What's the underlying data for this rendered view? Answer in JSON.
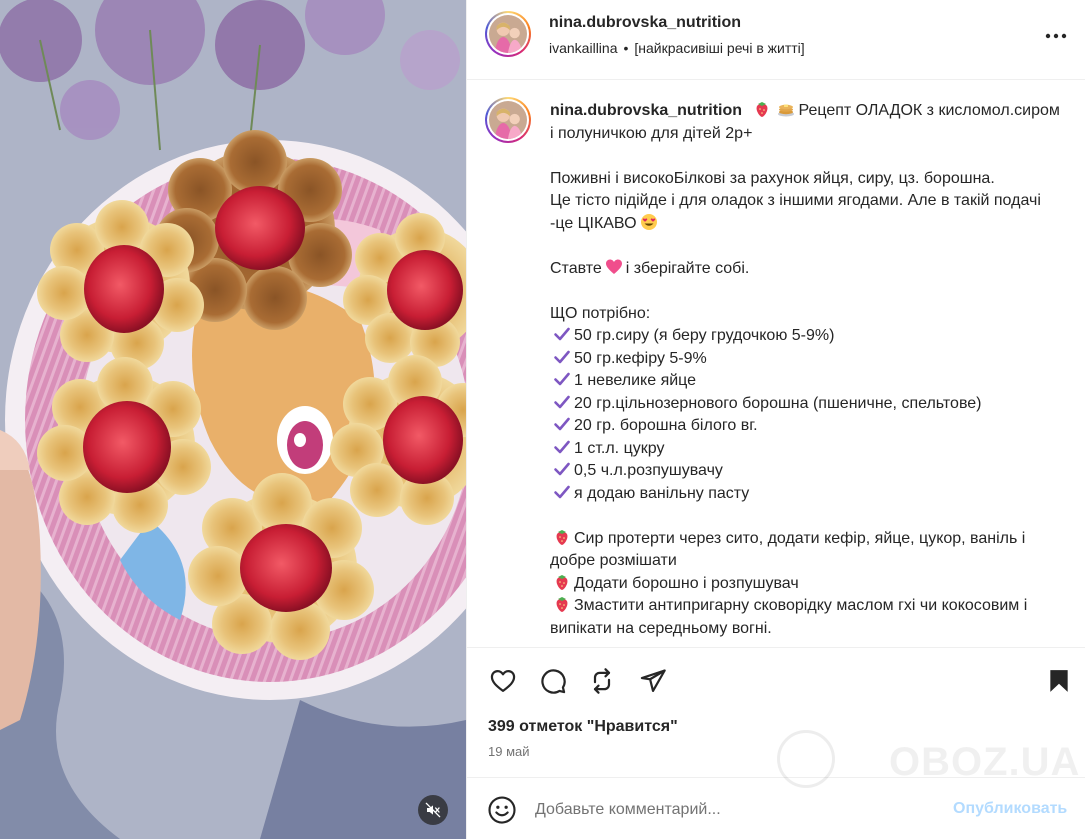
{
  "header": {
    "username": "nina.dubrovska_nutrition",
    "audio_artist": "ivankaillina",
    "audio_track": "[найкрасивіші речі в житті]",
    "separator": "•"
  },
  "caption": {
    "username": "nina.dubrovska_nutrition",
    "title": "Рецепт ОЛАДОК з кисломол.сиром і полуничкою для дітей 2р+",
    "intro_line1": "Поживні і високоБілкові за рахунок яйця, сиру, цз. борошна.",
    "intro_line2": "Це тісто підійде і для оладок з іншими ягодами. Але в такій подачі -це ЦІКАВО",
    "save_prefix": "Ставте",
    "save_suffix": "і зберігайте собі.",
    "needed_heading": "ЩО потрібно:",
    "ingredients": [
      "50 гр.сиру (я беру грудочкою 5-9%)",
      "50 гр.кефіру 5-9%",
      "1 невелике яйце",
      "20 гр.цільнозернового борошна (пшеничне, спельтове)",
      "20 гр. борошна білого вг.",
      "1 ст.л. цукру",
      "0,5 ч.л.розпушувачу",
      "я додаю ванільну пасту"
    ],
    "steps": [
      "Сир протерти через сито, додати кефір, яйце, цукор, ваніль і добре розмішати",
      "Додати борошно і розпушувач",
      "Змастити антипригарну сковорідку маслом гхі чи кокосовим і випікати на середньому вогні."
    ]
  },
  "actions": {
    "like_icon": "heart-icon",
    "comment_icon": "comment-bubble-icon",
    "repost_icon": "repost-icon",
    "share_icon": "paper-plane-icon",
    "save_icon": "bookmark-filled-icon"
  },
  "likes_text": "399 отметок \"Нравится\"",
  "date_text": "19 май",
  "comment": {
    "placeholder": "Добавьте комментарий...",
    "publish_label": "Опубликовать"
  },
  "watermark": "OBOZ.UA",
  "colors": {
    "text": "#262626",
    "secondary": "#737373",
    "publish_disabled": "#b3dbff",
    "check_purple": "#7e57c2",
    "strawberry": "#e53950"
  }
}
